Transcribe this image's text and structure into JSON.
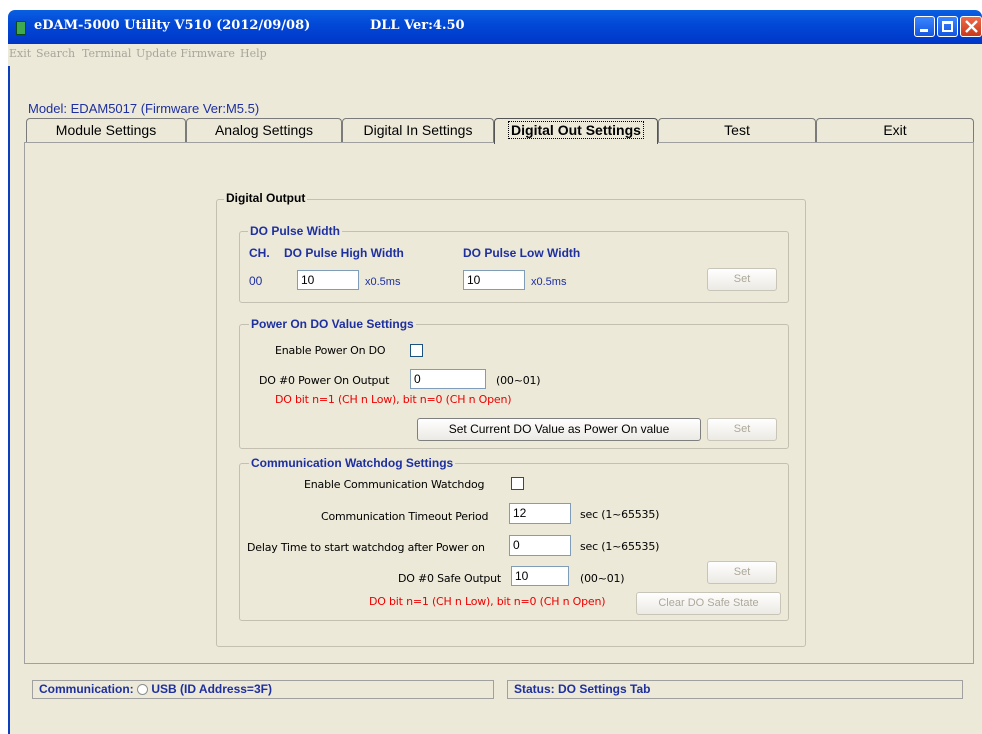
{
  "window": {
    "title": "eDAM-5000 Utility  V510 (2012/09/08)",
    "dll_version": "DLL Ver:4.50"
  },
  "menu": [
    "Exit",
    "Search",
    "Terminal",
    "Update Firmware",
    "Help"
  ],
  "model_label": "Model: EDAM5017 (Firmware Ver:M5.5)",
  "tabs": [
    "Module Settings",
    "Analog Settings",
    "Digital In Settings",
    "Digital Out Settings",
    "Test",
    "Exit"
  ],
  "active_tab": "Digital Out Settings",
  "digital_output": {
    "title": "Digital Output",
    "pulse": {
      "title": "DO Pulse Width",
      "ch_header": "CH.",
      "high_header": "DO Pulse High Width",
      "low_header": "DO Pulse Low Width",
      "channel": "00",
      "high_value": "10",
      "low_value": "10",
      "unit": "x0.5ms",
      "set_label": "Set"
    },
    "power_on": {
      "title": "Power On DO Value Settings",
      "enable_label": "Enable Power On DO",
      "output_label": "DO #0 Power On Output",
      "output_value": "0",
      "range": "(00~01)",
      "hint": "DO bit n=1 (CH n Low), bit n=0 (CH n Open)",
      "set_current_label": "Set Current DO Value as Power On value",
      "set_label": "Set"
    },
    "watchdog": {
      "title": "Communication Watchdog Settings",
      "enable_label": "Enable Communication Watchdog",
      "timeout_label": "Communication Timeout Period",
      "timeout_value": "12",
      "timeout_range": "sec (1~65535)",
      "delay_label": "Delay Time to start watchdog after Power on",
      "delay_value": "0",
      "delay_range": "sec (1~65535)",
      "safe_label": "DO #0 Safe Output",
      "safe_value": "10",
      "safe_range": "(00~01)",
      "hint": "DO bit n=1 (CH n Low), bit n=0 (CH n Open)",
      "set_label": "Set",
      "clear_label": "Clear DO Safe State"
    }
  },
  "status_bar": {
    "communication_label": "Communication:",
    "communication_value": "USB  (ID Address=3F)",
    "status": "Status: DO Settings Tab"
  },
  "colors": {
    "title_bar": "#0249d8",
    "panel_bg": "#ece9d8",
    "label_blue": "#1e2fa0",
    "hint_red": "#ee0000"
  }
}
